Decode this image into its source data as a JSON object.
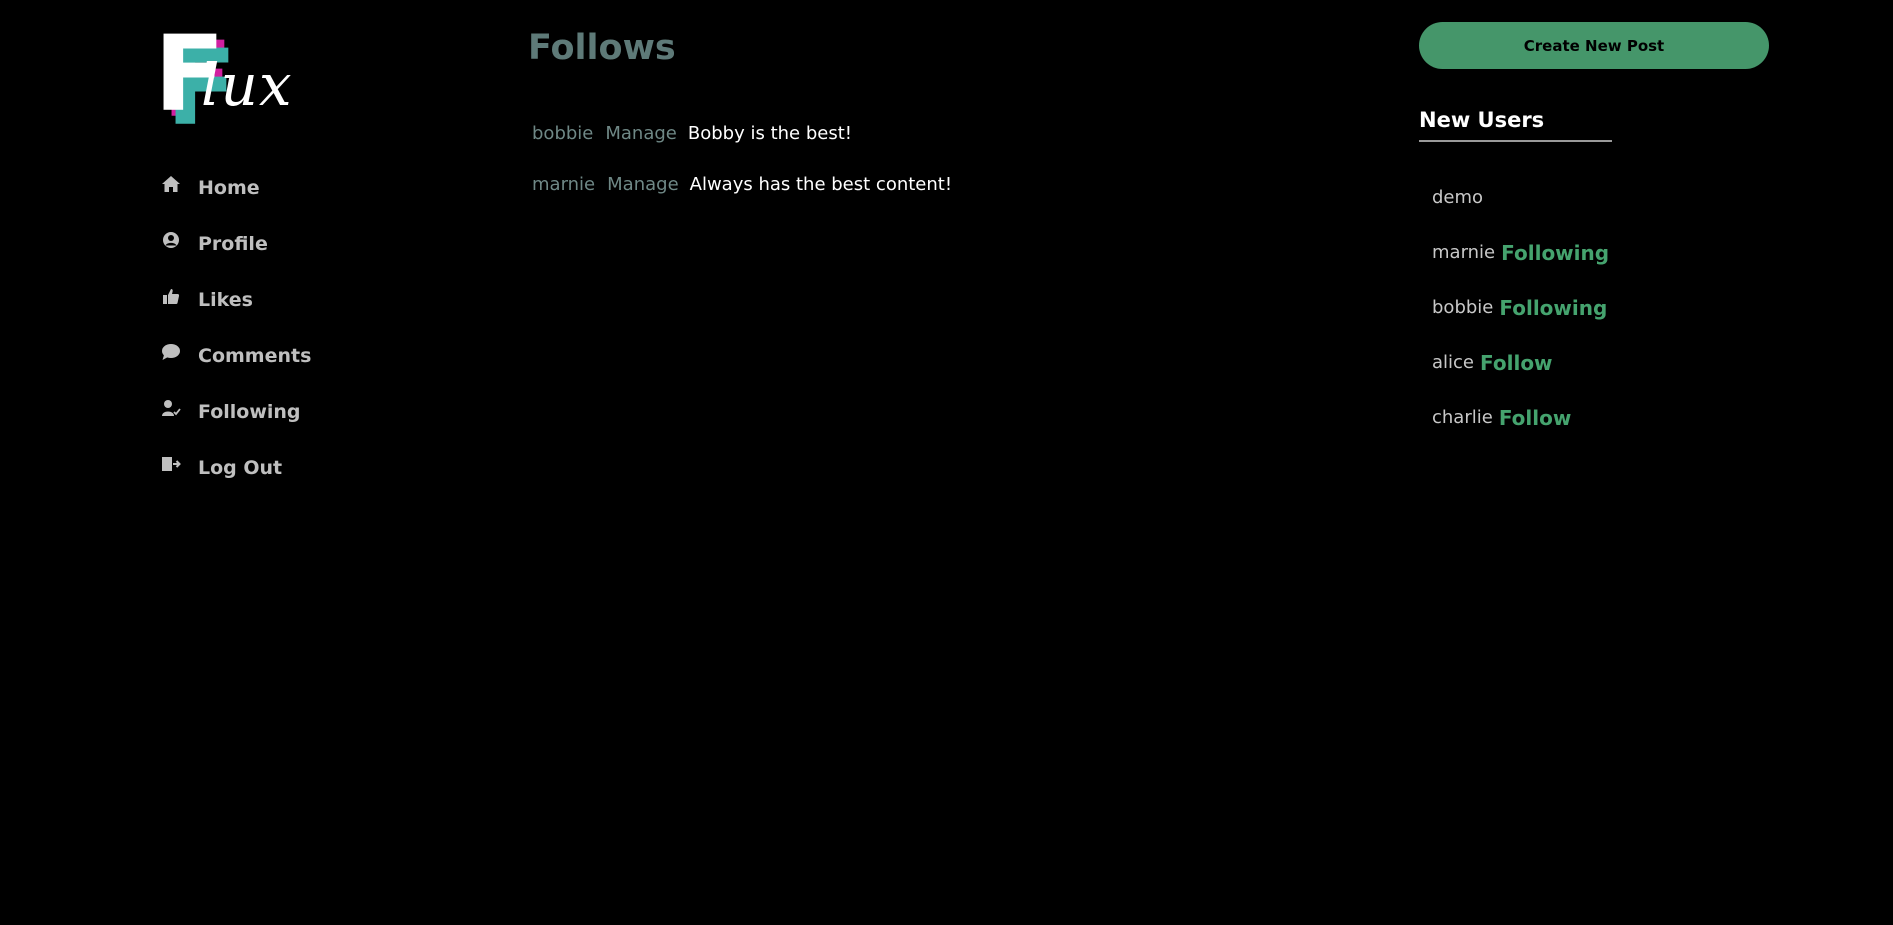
{
  "logo": {
    "text_initial": "F",
    "text_rest": "lux"
  },
  "nav": {
    "items": [
      {
        "label": "Home",
        "icon": "home-icon"
      },
      {
        "label": "Profile",
        "icon": "user-circle-icon"
      },
      {
        "label": "Likes",
        "icon": "thumbs-up-icon"
      },
      {
        "label": "Comments",
        "icon": "comment-icon"
      },
      {
        "label": "Following",
        "icon": "user-check-icon"
      },
      {
        "label": "Log Out",
        "icon": "logout-icon"
      }
    ]
  },
  "main": {
    "title": "Follows",
    "follows": [
      {
        "user": "bobbie",
        "manage": "Manage",
        "note": "Bobby is the best!"
      },
      {
        "user": "marnie",
        "manage": "Manage",
        "note": "Always has the best content!"
      }
    ]
  },
  "sidebar_right": {
    "create_label": "Create New Post",
    "new_users_title": "New Users",
    "users": [
      {
        "name": "demo",
        "action": ""
      },
      {
        "name": "marnie",
        "action": "Following"
      },
      {
        "name": "bobbie",
        "action": "Following"
      },
      {
        "name": "alice",
        "action": "Follow"
      },
      {
        "name": "charlie",
        "action": "Follow"
      }
    ]
  },
  "colors": {
    "background": "#000000",
    "accent_green": "#45966a",
    "title_teal": "#5e7a78",
    "logo_magenta": "#d11fa0",
    "logo_teal": "#3cb0a8"
  }
}
